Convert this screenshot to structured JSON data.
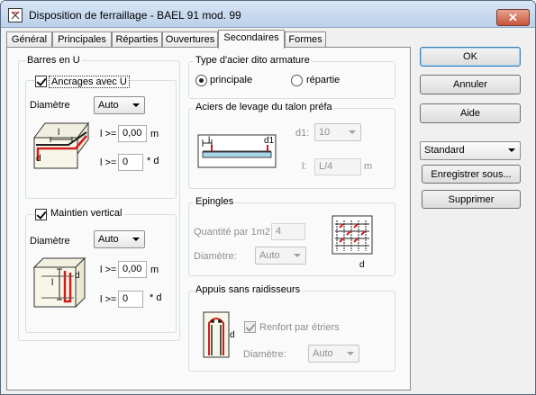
{
  "window": {
    "title": "Disposition de ferraillage - BAEL 91 mod. 99",
    "close_label": "✕"
  },
  "tabs": [
    "Général",
    "Principales",
    "Réparties",
    "Ouvertures",
    "Secondaires",
    "Formes"
  ],
  "active_tab": "Secondaires",
  "barres_u": {
    "group_label": "Barres en U",
    "ancrages": {
      "label": "Ancrages avec U",
      "checked": true,
      "diametre_label": "Diamètre",
      "diametre_value": "Auto",
      "l_label": "l >=",
      "l_value": "0,00",
      "l_unit": "m",
      "l2_label": "l >=",
      "l2_value": "0",
      "l2_unit": "* d",
      "fig_label_l": "l",
      "fig_label_d": "d"
    },
    "maintien": {
      "label": "Maintien vertical",
      "checked": true,
      "diametre_label": "Diamètre",
      "diametre_value": "Auto",
      "l_label": "l >=",
      "l_value": "0,00",
      "l_unit": "m",
      "l2_label": "l >=",
      "l2_value": "0",
      "l2_unit": "* d",
      "fig_label_l": "l",
      "fig_label_d": "d"
    }
  },
  "type_acier": {
    "group_label": "Type d'acier dito armature",
    "opt1": "principale",
    "opt2": "répartie",
    "selected": "principale"
  },
  "aciers_levage": {
    "group_label": "Aciers de levage du talon préfa",
    "d1_label": "d1:",
    "d1_value": "10",
    "l_label": "l:",
    "l_value": "L/4",
    "l_unit": "m",
    "fig_label_l": "l",
    "fig_label_d1": "d1"
  },
  "epingles": {
    "group_label": "Epingles",
    "quantite_label": "Quantité par 1m2",
    "quantite_value": "4",
    "diametre_label": "Diamètre:",
    "diametre_value": "Auto",
    "fig_label_d": "d"
  },
  "appuis": {
    "group_label": "Appuis sans raidisseurs",
    "renfort_label": "Renfort par étriers",
    "renfort_checked": true,
    "diametre_label": "Diamètre:",
    "diametre_value": "Auto",
    "fig_label_d": "d"
  },
  "buttons": {
    "ok": "OK",
    "annuler": "Annuler",
    "aide": "Aide",
    "standard": "Standard",
    "enregistrer": "Enregistrer sous...",
    "supprimer": "Supprimer"
  },
  "colors": {
    "rebar_red": "#d21c1c",
    "slab_blue": "#a8d4ea",
    "accent": "#3c7fb1"
  }
}
